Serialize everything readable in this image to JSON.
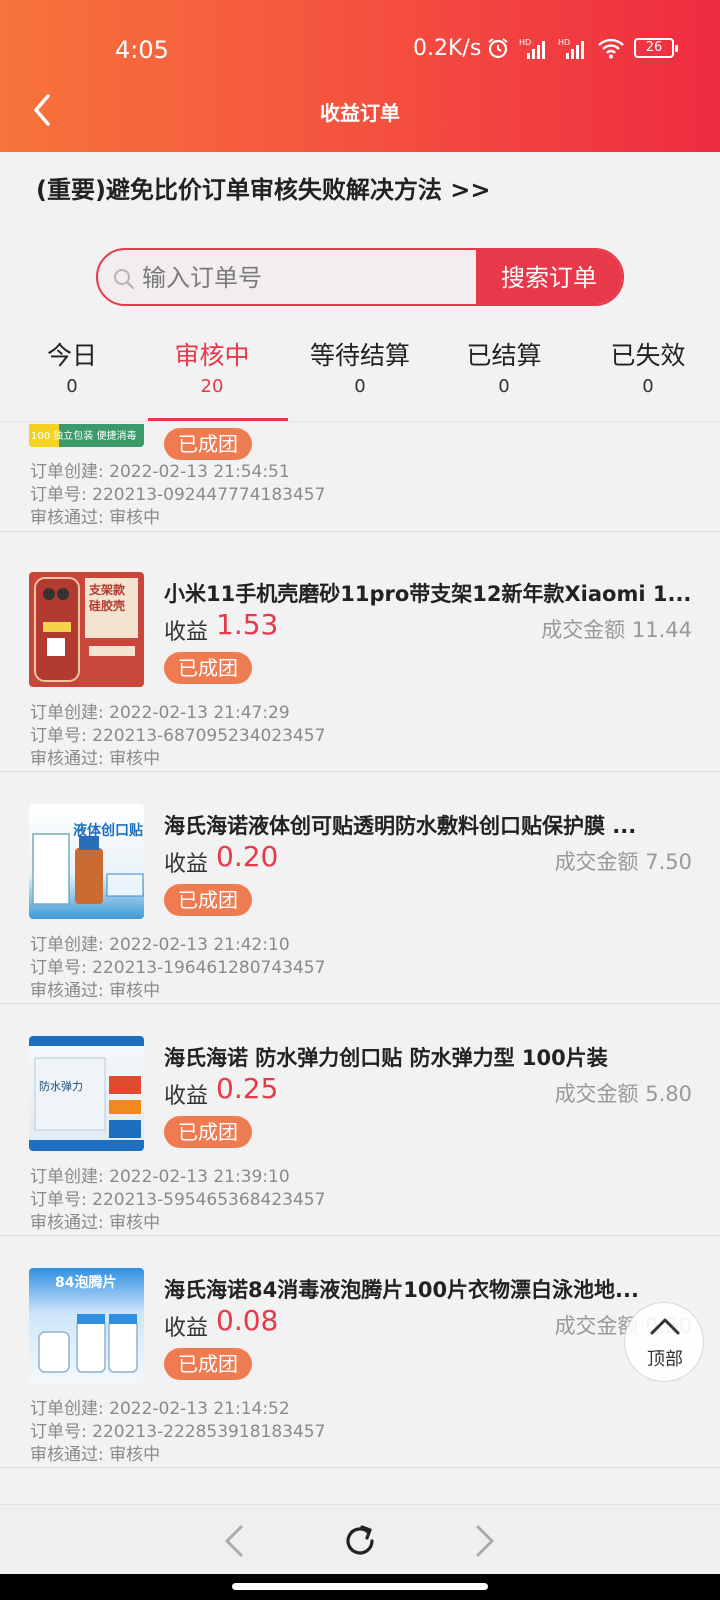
{
  "status_bar": {
    "time": "4:05",
    "speed": "0.2K/s",
    "battery": "26"
  },
  "nav": {
    "title": "收益订单"
  },
  "notice": {
    "text": "(重要)避免比价订单审核失败解决方法 >>"
  },
  "search": {
    "placeholder": "输入订单号",
    "button": "搜索订单"
  },
  "tabs": [
    {
      "label": "今日",
      "count": "0"
    },
    {
      "label": "审核中",
      "count": "20"
    },
    {
      "label": "等待结算",
      "count": "0"
    },
    {
      "label": "已结算",
      "count": "0"
    },
    {
      "label": "已失效",
      "count": "0"
    }
  ],
  "orders": [
    {
      "title": "",
      "earn_label": "",
      "earn": "",
      "amount": "",
      "badge": "已成团",
      "created": "订单创建: 2022-02-13 21:54:51",
      "order_no": "订单号: 220213-092447774183457",
      "review": "审核通过: 审核中",
      "thumb_text": "100 独立包装 便捷消毒"
    },
    {
      "title": "小米11手机壳磨砂11pro带支架12新年款Xiaomi 1...",
      "earn_label": "收益",
      "earn": "1.53",
      "amount": "成交金额 11.44",
      "badge": "已成团",
      "created": "订单创建: 2022-02-13 21:47:29",
      "order_no": "订单号: 220213-687095234023457",
      "review": "审核通过: 审核中",
      "thumb_text": "支架款 硅胶壳"
    },
    {
      "title": "海氏海诺液体创可贴透明防水敷料创口贴保护膜 ...",
      "earn_label": "收益",
      "earn": "0.20",
      "amount": "成交金额 7.50",
      "badge": "已成团",
      "created": "订单创建: 2022-02-13 21:42:10",
      "order_no": "订单号: 220213-196461280743457",
      "review": "审核通过: 审核中",
      "thumb_text": "液体创口贴"
    },
    {
      "title": "海氏海诺 防水弹力创口贴 防水弹力型 100片装",
      "earn_label": "收益",
      "earn": "0.25",
      "amount": "成交金额 5.80",
      "badge": "已成团",
      "created": "订单创建: 2022-02-13 21:39:10",
      "order_no": "订单号: 220213-595465368423457",
      "review": "审核通过: 审核中",
      "thumb_text": "防水弹力"
    },
    {
      "title": "海氏海诺84消毒液泡腾片100片衣物漂白泳池地...",
      "earn_label": "收益",
      "earn": "0.08",
      "amount": "成交金额 0.50",
      "badge": "已成团",
      "created": "订单创建: 2022-02-13 21:14:52",
      "order_no": "订单号: 220213-222853918183457",
      "review": "审核通过: 审核中",
      "thumb_text": "84泡腾片"
    }
  ],
  "back_to_top": {
    "label": "顶部"
  },
  "colors": {
    "accent": "#e8394a",
    "badge": "#ef7b52",
    "header_start": "#f7743a",
    "header_end": "#ef2b40"
  }
}
